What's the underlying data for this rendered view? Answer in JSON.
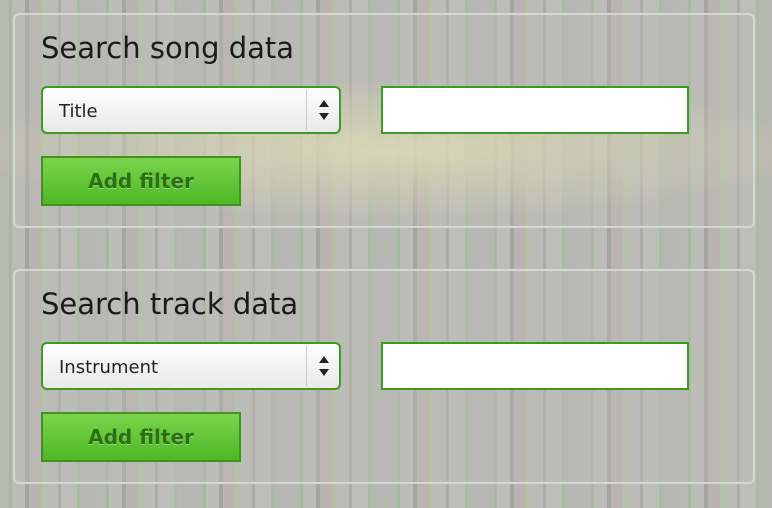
{
  "song_search": {
    "title": "Search song data",
    "field_select": {
      "selected": "Title"
    },
    "query_input": {
      "value": "",
      "placeholder": ""
    },
    "add_filter_label": "Add filter"
  },
  "track_search": {
    "title": "Search track data",
    "field_select": {
      "selected": "Instrument"
    },
    "query_input": {
      "value": "",
      "placeholder": ""
    },
    "add_filter_label": "Add filter"
  },
  "icons": {
    "select_arrows": "up-down-arrows-icon"
  },
  "colors": {
    "accent_green": "#3c9a25",
    "button_green": "#5cc132",
    "button_text": "#2c6f17"
  }
}
